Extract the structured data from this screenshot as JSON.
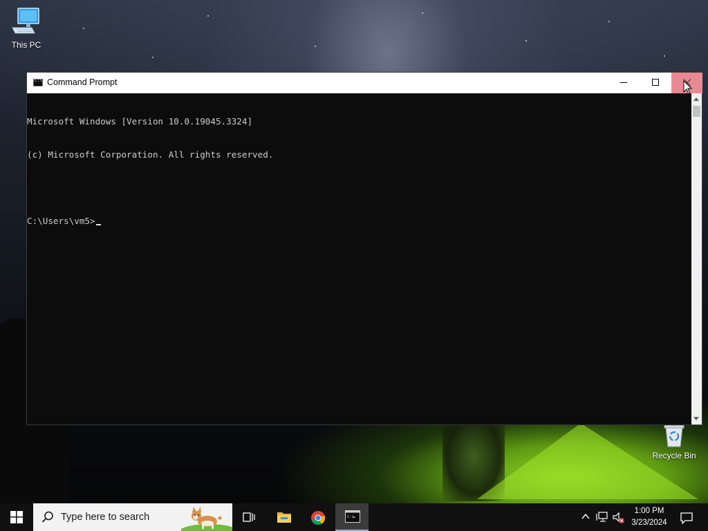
{
  "desktop": {
    "icons": [
      {
        "label": "This PC"
      },
      {
        "label": "Recycle Bin"
      }
    ]
  },
  "window": {
    "title": "Command Prompt",
    "minimize_icon": "minimize-icon",
    "maximize_icon": "maximize-icon",
    "close_icon": "close-icon"
  },
  "console": {
    "lines": [
      "Microsoft Windows [Version 10.0.19045.3324]",
      "(c) Microsoft Corporation. All rights reserved.",
      "",
      "C:\\Users\\vm5>"
    ]
  },
  "taskbar": {
    "search_placeholder": "Type here to search",
    "apps": [
      {
        "name": "Task View",
        "icon": "task-view-icon"
      },
      {
        "name": "File Explorer",
        "icon": "folder-icon"
      },
      {
        "name": "Google Chrome",
        "icon": "chrome-icon"
      },
      {
        "name": "Command Prompt",
        "icon": "cmd-icon",
        "active": true
      }
    ],
    "tray": {
      "time": "1:00 PM",
      "date": "3/23/2024"
    }
  },
  "colors": {
    "console_bg": "#0c0c0c",
    "console_text": "#cccccc",
    "close_hover": "#e98a92",
    "taskbar_bg": "#101010",
    "active_accent": "#76b9ed"
  }
}
